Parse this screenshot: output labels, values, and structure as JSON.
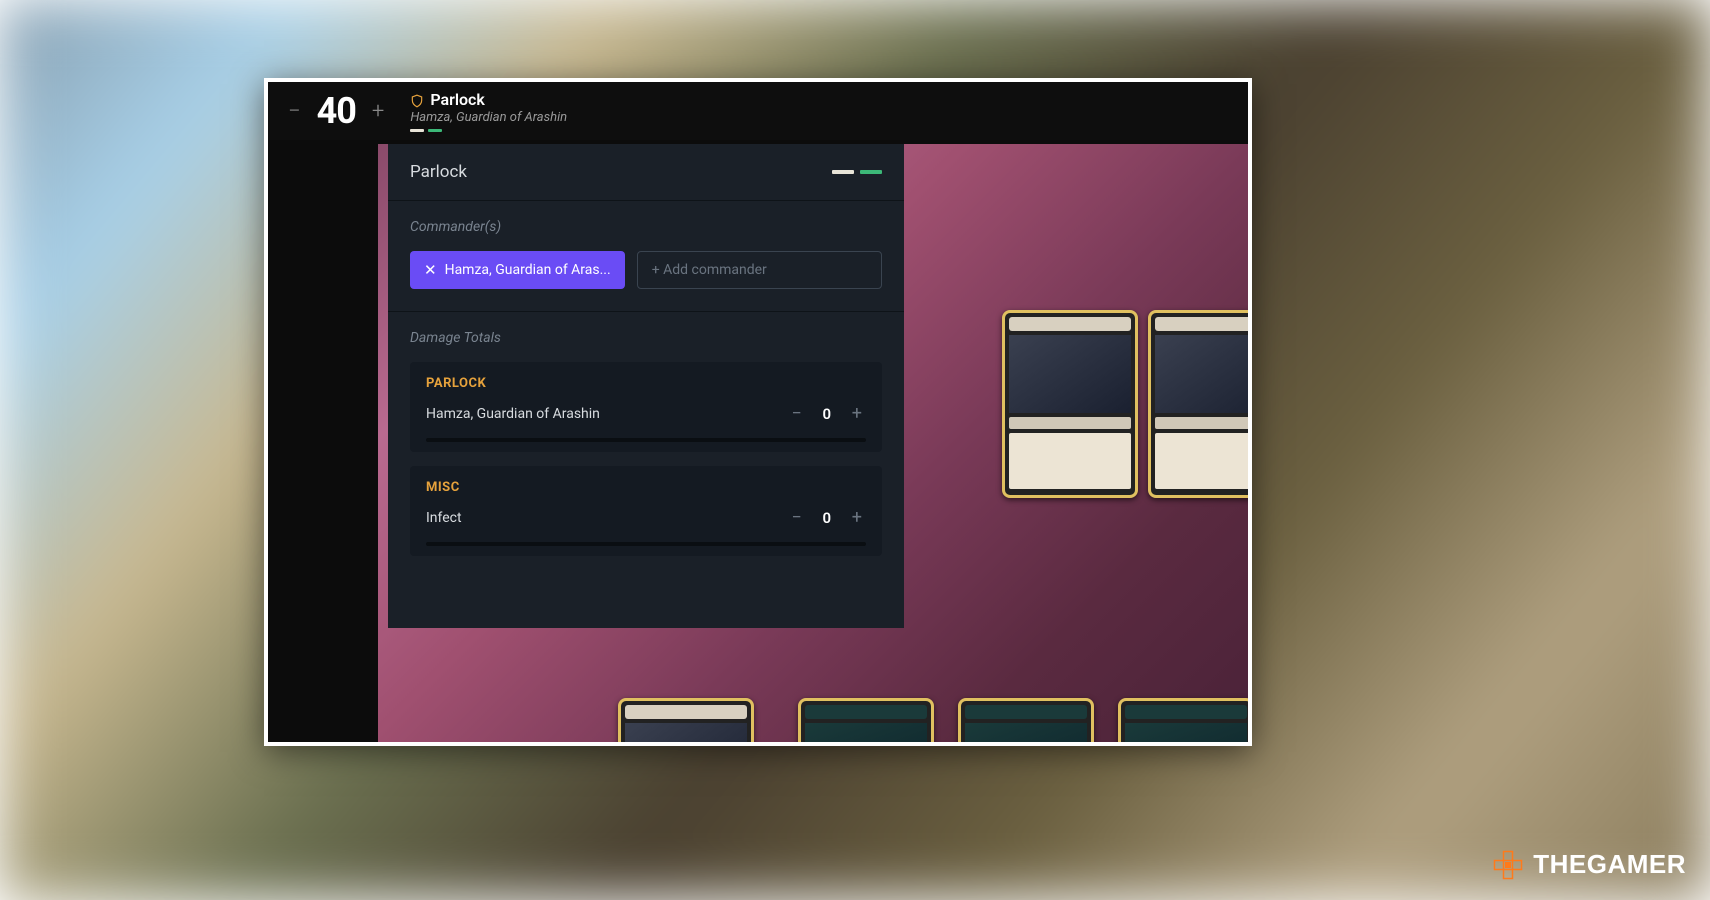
{
  "player": {
    "name": "Parlock",
    "life": "40",
    "commander_subtitle": "Hamza, Guardian of Arashin"
  },
  "panel": {
    "title": "Parlock",
    "commanders_label": "Commander(s)",
    "commander_chip": "Hamza, Guardian of Aras...",
    "add_commander_placeholder": "+ Add commander",
    "damage_totals_label": "Damage Totals",
    "groups": [
      {
        "title": "PARLOCK",
        "rows": [
          {
            "label": "Hamza, Guardian of Arashin",
            "value": "0"
          }
        ]
      },
      {
        "title": "MISC",
        "rows": [
          {
            "label": "Infect",
            "value": "0"
          }
        ]
      }
    ]
  },
  "watermark": "THEGAMER",
  "colors": {
    "accent": "#6a4cf5",
    "group_title": "#e6a23c"
  }
}
